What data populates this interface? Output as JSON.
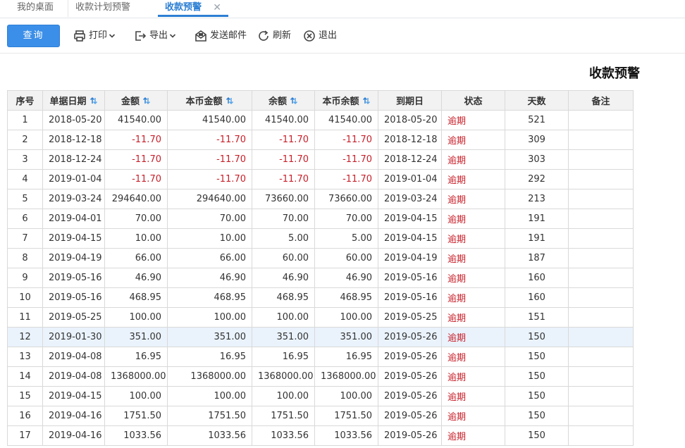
{
  "tabs": [
    {
      "label": "我的桌面"
    },
    {
      "label": "收款计划预警"
    },
    {
      "label": "收款预警",
      "close": "✕"
    }
  ],
  "toolbar": {
    "query": "查询",
    "print": "打印",
    "export": "导出",
    "send_mail": "发送邮件",
    "refresh": "刷新",
    "exit": "退出"
  },
  "report_title": "收款预警",
  "table": {
    "columns": [
      "序号",
      "单据日期",
      "金额",
      "本币金额",
      "余额",
      "本币余额",
      "到期日",
      "状态",
      "天数",
      "备注"
    ],
    "rows": [
      {
        "no": "1",
        "date": "2018-05-20",
        "amount": "41540.00",
        "local_amount": "41540.00",
        "balance": "41540.00",
        "local_balance": "41540.00",
        "due": "2018-05-20",
        "status": "逾期",
        "days": "521",
        "note": ""
      },
      {
        "no": "2",
        "date": "2018-12-18",
        "amount": "-11.70",
        "local_amount": "-11.70",
        "balance": "-11.70",
        "local_balance": "-11.70",
        "due": "2018-12-18",
        "status": "逾期",
        "days": "309",
        "note": ""
      },
      {
        "no": "3",
        "date": "2018-12-24",
        "amount": "-11.70",
        "local_amount": "-11.70",
        "balance": "-11.70",
        "local_balance": "-11.70",
        "due": "2018-12-24",
        "status": "逾期",
        "days": "303",
        "note": ""
      },
      {
        "no": "4",
        "date": "2019-01-04",
        "amount": "-11.70",
        "local_amount": "-11.70",
        "balance": "-11.70",
        "local_balance": "-11.70",
        "due": "2019-01-04",
        "status": "逾期",
        "days": "292",
        "note": ""
      },
      {
        "no": "5",
        "date": "2019-03-24",
        "amount": "294640.00",
        "local_amount": "294640.00",
        "balance": "73660.00",
        "local_balance": "73660.00",
        "due": "2019-03-24",
        "status": "逾期",
        "days": "213",
        "note": ""
      },
      {
        "no": "6",
        "date": "2019-04-01",
        "amount": "70.00",
        "local_amount": "70.00",
        "balance": "70.00",
        "local_balance": "70.00",
        "due": "2019-04-15",
        "status": "逾期",
        "days": "191",
        "note": ""
      },
      {
        "no": "7",
        "date": "2019-04-15",
        "amount": "10.00",
        "local_amount": "10.00",
        "balance": "5.00",
        "local_balance": "5.00",
        "due": "2019-04-15",
        "status": "逾期",
        "days": "191",
        "note": ""
      },
      {
        "no": "8",
        "date": "2019-04-19",
        "amount": "66.00",
        "local_amount": "66.00",
        "balance": "60.00",
        "local_balance": "60.00",
        "due": "2019-04-19",
        "status": "逾期",
        "days": "187",
        "note": ""
      },
      {
        "no": "9",
        "date": "2019-05-16",
        "amount": "46.90",
        "local_amount": "46.90",
        "balance": "46.90",
        "local_balance": "46.90",
        "due": "2019-05-16",
        "status": "逾期",
        "days": "160",
        "note": ""
      },
      {
        "no": "10",
        "date": "2019-05-16",
        "amount": "468.95",
        "local_amount": "468.95",
        "balance": "468.95",
        "local_balance": "468.95",
        "due": "2019-05-16",
        "status": "逾期",
        "days": "160",
        "note": ""
      },
      {
        "no": "11",
        "date": "2019-05-25",
        "amount": "100.00",
        "local_amount": "100.00",
        "balance": "100.00",
        "local_balance": "100.00",
        "due": "2019-05-25",
        "status": "逾期",
        "days": "151",
        "note": ""
      },
      {
        "no": "12",
        "date": "2019-01-30",
        "amount": "351.00",
        "local_amount": "351.00",
        "balance": "351.00",
        "local_balance": "351.00",
        "due": "2019-05-26",
        "status": "逾期",
        "days": "150",
        "note": ""
      },
      {
        "no": "13",
        "date": "2019-04-08",
        "amount": "16.95",
        "local_amount": "16.95",
        "balance": "16.95",
        "local_balance": "16.95",
        "due": "2019-05-26",
        "status": "逾期",
        "days": "150",
        "note": ""
      },
      {
        "no": "14",
        "date": "2019-04-08",
        "amount": "1368000.00",
        "local_amount": "1368000.00",
        "balance": "1368000.00",
        "local_balance": "1368000.00",
        "due": "2019-05-26",
        "status": "逾期",
        "days": "150",
        "note": ""
      },
      {
        "no": "15",
        "date": "2019-04-15",
        "amount": "100.00",
        "local_amount": "100.00",
        "balance": "100.00",
        "local_balance": "100.00",
        "due": "2019-05-26",
        "status": "逾期",
        "days": "150",
        "note": ""
      },
      {
        "no": "16",
        "date": "2019-04-16",
        "amount": "1751.50",
        "local_amount": "1751.50",
        "balance": "1751.50",
        "local_balance": "1751.50",
        "due": "2019-05-26",
        "status": "逾期",
        "days": "150",
        "note": ""
      },
      {
        "no": "17",
        "date": "2019-04-16",
        "amount": "1033.56",
        "local_amount": "1033.56",
        "balance": "1033.56",
        "local_balance": "1033.56",
        "due": "2019-05-26",
        "status": "逾期",
        "days": "150",
        "note": ""
      }
    ]
  },
  "colors": {
    "accent": "#3b8fe8",
    "negative": "#c8202a",
    "selected_row": "#eaf3fc"
  },
  "icons": {
    "print": "printer-icon",
    "export": "export-icon",
    "send_mail": "mail-icon",
    "refresh": "refresh-icon",
    "exit": "close-circle-icon",
    "sort": "sort-arrows-icon"
  }
}
